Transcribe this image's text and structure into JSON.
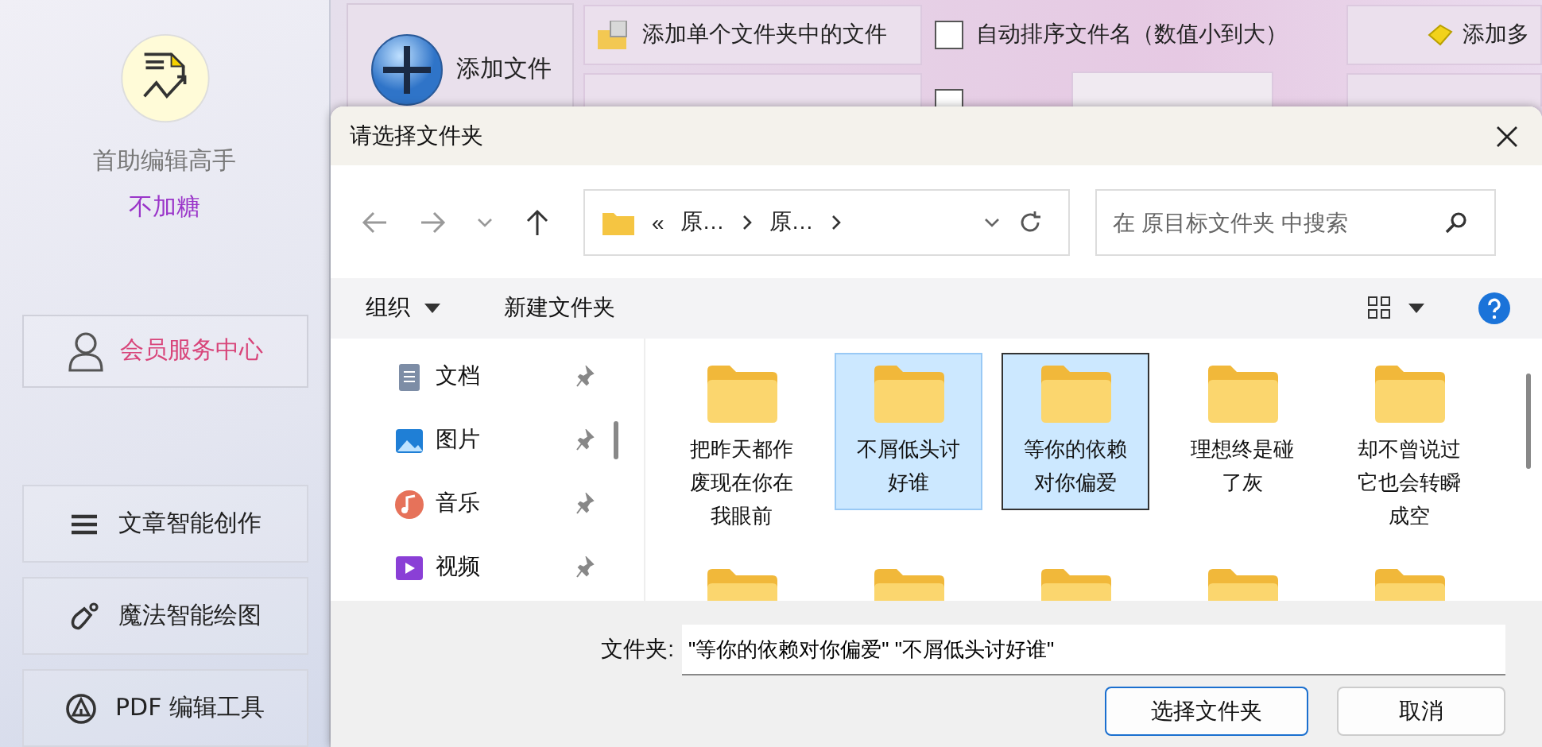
{
  "sidebar": {
    "app_name": "首助编辑高手",
    "user_name": "不加糖",
    "member_button": {
      "label": "会员服务中心"
    },
    "menu": [
      {
        "label": "文章智能创作",
        "kind": "list"
      },
      {
        "label": "魔法智能绘图",
        "kind": "brush"
      },
      {
        "label": "PDF 编辑工具",
        "kind": "pdf"
      }
    ]
  },
  "toolbar": {
    "add_file": {
      "label": "添加文件"
    },
    "rows": [
      [
        {
          "kind": "button",
          "label": "添加单个文件夹中的文件"
        },
        {
          "kind": "checkbox",
          "label": "自动排序文件名（数值小到大）",
          "checked": false
        },
        {
          "kind": "side_button",
          "label": "添加多"
        }
      ],
      [
        {
          "kind": "button"
        },
        {
          "kind": "checkbox_field",
          "checked": false
        },
        {
          "kind": "side_button"
        }
      ]
    ]
  },
  "dialog": {
    "title": "请选择文件夹",
    "address": {
      "prefix": "«",
      "crumbs": [
        "原…",
        "原…"
      ]
    },
    "search": {
      "placeholder": "在 原目标文件夹 中搜索"
    },
    "commands": [
      {
        "label": "组织",
        "dropdown": true
      },
      {
        "label": "新建文件夹",
        "dropdown": false
      }
    ],
    "nav_pane": [
      {
        "label": "文档",
        "kind": "documents",
        "pinned": true
      },
      {
        "label": "图片",
        "kind": "pictures",
        "pinned": true
      },
      {
        "label": "音乐",
        "kind": "music",
        "pinned": true
      },
      {
        "label": "视频",
        "kind": "videos",
        "pinned": true
      }
    ],
    "folders": [
      {
        "name": "把昨天都作废现在你在我眼前",
        "selected": false,
        "focused": false
      },
      {
        "name": "不屑低头讨好谁",
        "selected": true,
        "focused": false
      },
      {
        "name": "等你的依赖对你偏爱",
        "selected": true,
        "focused": true
      },
      {
        "name": "理想终是碰了灰",
        "selected": false,
        "focused": false
      },
      {
        "name": "却不曾说过它也会转瞬成空",
        "selected": false,
        "focused": false
      },
      {
        "selected": false,
        "focused": false
      },
      {
        "selected": false,
        "focused": false
      },
      {
        "selected": false,
        "focused": false
      },
      {
        "selected": false,
        "focused": false
      },
      {
        "selected": false,
        "focused": false
      }
    ],
    "folder_label": "文件夹:",
    "folder_value": "\"等你的依赖对你偏爱\" \"不屑低头讨好谁\"",
    "buttons": [
      {
        "label": "选择文件夹",
        "kind": "primary"
      },
      {
        "label": "取消",
        "kind": "secondary"
      }
    ]
  }
}
